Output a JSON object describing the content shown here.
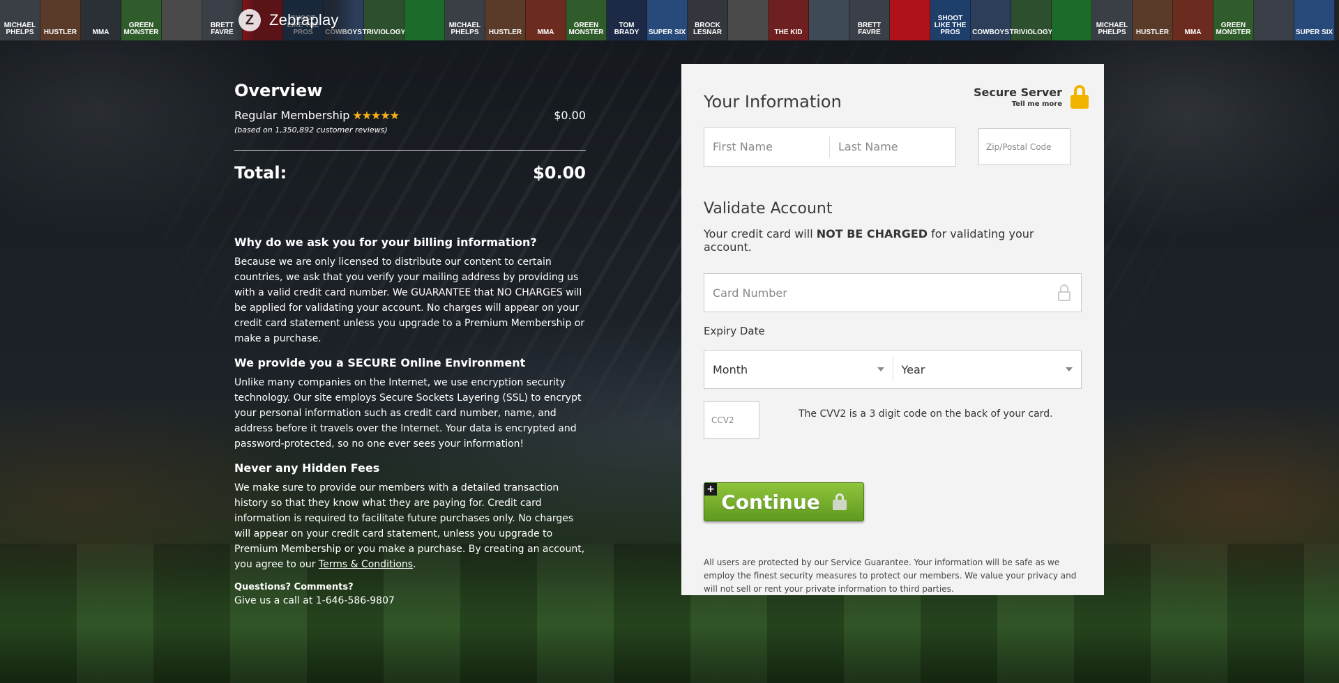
{
  "header": {
    "brand_name": "Zebraplay",
    "tiles": [
      {
        "text": "MICHAEL PHELPS",
        "color": "#3a3f45"
      },
      {
        "text": "HUSTLER",
        "color": "#5a3b2a"
      },
      {
        "text": "MMA",
        "color": "#2b2f36"
      },
      {
        "text": "GREEN MONSTER",
        "color": "#2f5c2a"
      },
      {
        "text": "",
        "color": "#4a4a4a"
      },
      {
        "text": "BRETT FAVRE",
        "color": "#3b3f47"
      },
      {
        "text": "",
        "color": "#b0121b"
      },
      {
        "text": "SHOOT LIKE THE PROS",
        "color": "#1f3f6b"
      },
      {
        "text": "COWBOYS",
        "color": "#2c3e5a"
      },
      {
        "text": "TRIVIOLOGY",
        "color": "#2d4f2d"
      },
      {
        "text": "",
        "color": "#1d6b2b"
      },
      {
        "text": "MICHAEL PHELPS",
        "color": "#3a3f45"
      },
      {
        "text": "HUSTLER",
        "color": "#5a3b2a"
      },
      {
        "text": "MMA",
        "color": "#6b2b1e"
      },
      {
        "text": "GREEN MONSTER",
        "color": "#2f5c2a"
      },
      {
        "text": "TOM BRADY",
        "color": "#1d2a45"
      },
      {
        "text": "SUPER SIX",
        "color": "#274a7a"
      },
      {
        "text": "BROCK LESNAR",
        "color": "#33373d"
      },
      {
        "text": "",
        "color": "#4b4b4b"
      },
      {
        "text": "THE KID",
        "color": "#6e1f1f"
      },
      {
        "text": "",
        "color": "#3e4a55"
      },
      {
        "text": "BRETT FAVRE",
        "color": "#3b3f47"
      },
      {
        "text": "",
        "color": "#b0121b"
      },
      {
        "text": "SHOOT LIKE THE PROS",
        "color": "#1f3f6b"
      },
      {
        "text": "COWBOYS",
        "color": "#2c3e5a"
      },
      {
        "text": "TRIVIOLOGY",
        "color": "#2d4f2d"
      },
      {
        "text": "",
        "color": "#1d6b2b"
      },
      {
        "text": "MICHAEL PHELPS",
        "color": "#3a3f45"
      },
      {
        "text": "HUSTLER",
        "color": "#5a3b2a"
      },
      {
        "text": "MMA",
        "color": "#6b2b1e"
      },
      {
        "text": "GREEN MONSTER",
        "color": "#2f5c2a"
      },
      {
        "text": "",
        "color": "#3b3f47"
      },
      {
        "text": "SUPER SIX",
        "color": "#274a7a"
      }
    ]
  },
  "overview": {
    "title": "Overview",
    "membership_label": "Regular Membership",
    "rating_stars": "★★★★★",
    "membership_price": "$0.00",
    "reviews_note": "(based on 1,350,892 customer reviews)",
    "total_label": "Total:",
    "total_value": "$0.00"
  },
  "faq": {
    "billing_heading": "Why do we ask you for your billing information?",
    "billing_text": "Because we are only licensed to distribute our content to certain countries, we ask that you verify your mailing address by providing us with a valid credit card number. We GUARANTEE that NO CHARGES will be applied for validating your account. No charges will appear on your credit card statement unless you upgrade to a Premium Membership or make a purchase.",
    "secure_heading": "We provide you a SECURE Online Environment",
    "secure_text": "Unlike many companies on the Internet, we use encryption security technology. Our site employs Secure Sockets Layering (SSL) to encrypt your personal information such as credit card number, name, and address before it travels over the Internet. Your data is encrypted and password-protected, so no one ever sees your information!",
    "fees_heading": "Never any Hidden Fees",
    "fees_text": "We make sure to provide our members with a detailed transaction history so that they know what they are paying for. Credit card information is required to facilitate future purchases only. No charges will appear on your credit card statement, unless you upgrade to Premium Membership or you make a purchase. By creating an account, you agree to our",
    "terms_link": "Terms & Conditions",
    "terms_end": "."
  },
  "contact": {
    "question": "Questions? Comments?",
    "phone_line": "Give us a call at 1-646-586-9807"
  },
  "form": {
    "title": "Your Information",
    "secure_title": "Secure Server",
    "secure_link": "Tell me more",
    "first_name_placeholder": "First Name",
    "last_name_placeholder": "Last Name",
    "zip_placeholder": "Zip/Postal Code",
    "validate_title": "Validate Account",
    "validate_pre": "Your credit card will ",
    "validate_bold": "NOT BE CHARGED",
    "validate_post": " for validating your account.",
    "card_placeholder": "Card Number",
    "expiry_label": "Expiry Date",
    "month_value": "Month",
    "year_value": "Year",
    "cvv_placeholder": "CCV2",
    "cvv_help": "The CVV2 is a 3 digit code on the back of your card.",
    "continue_label": "Continue",
    "plus_symbol": "+",
    "guarantee_text": "All users are protected by our Service Guarantee. Your information will be safe as we employ the finest security measures to protect our members. We value your privacy and will not sell or rent your private information to third parties."
  },
  "colors": {
    "accent_green": "#6fab2a",
    "star_gold": "#f6b11a",
    "lock_gold": "#f0b400",
    "panel_bg": "#f3f3f3"
  }
}
